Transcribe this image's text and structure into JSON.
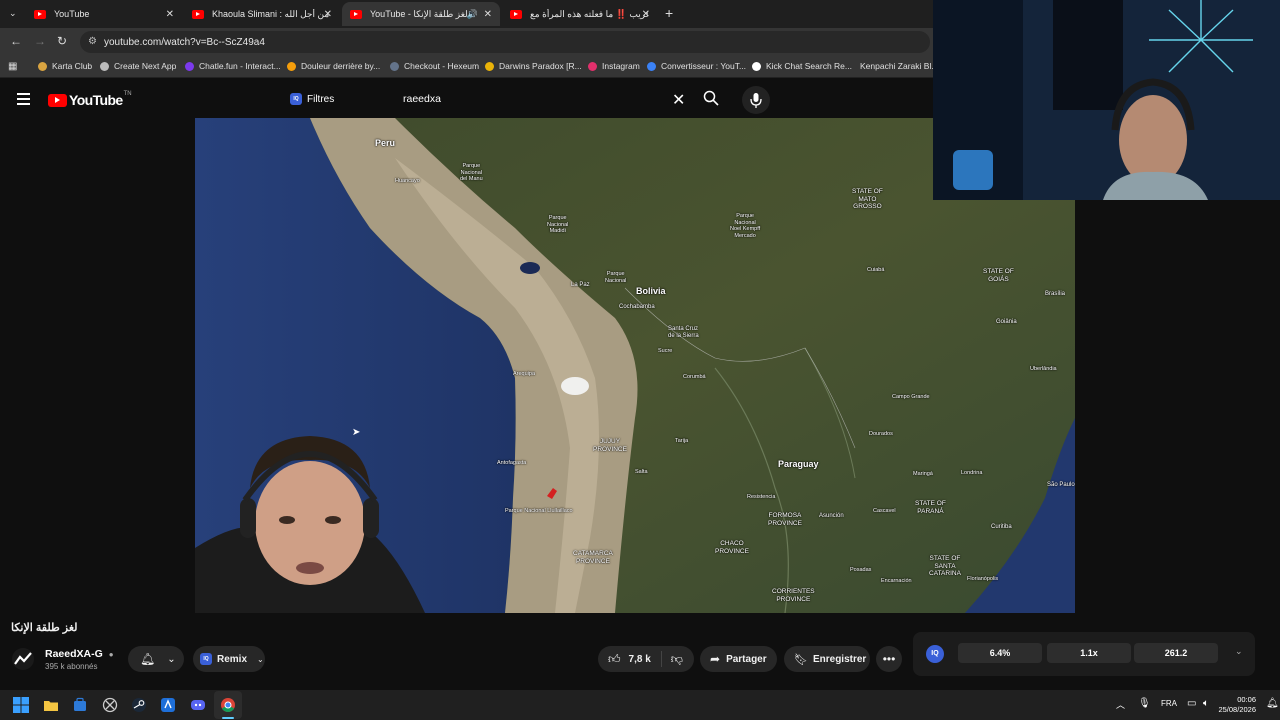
{
  "browser": {
    "tabs": [
      {
        "label": "YouTube",
        "active": false
      },
      {
        "label": "Khaoula Slimani : لو عيّ من أجل الله",
        "active": false
      },
      {
        "label": "YouTube - لغز طلقة الإنكا",
        "active": true
      },
      {
        "label": "عريب ‼️ ما فعلته هذه المرأة مع ..",
        "active": false
      }
    ],
    "new_tab_label": "+",
    "url": "youtube.com/watch?v=Bc--ScZ49a4",
    "bookmarks": [
      {
        "label": "Karta Club",
        "color": "#d9a441"
      },
      {
        "label": "Create Next App",
        "color": "#bbbbbb"
      },
      {
        "label": "Chatle.fun - Interact...",
        "color": "#7c3aed"
      },
      {
        "label": "Douleur derrière by...",
        "color": "#f59e0b"
      },
      {
        "label": "Checkout - Hexeum",
        "color": "#64748b"
      },
      {
        "label": "Darwins Paradox [R...",
        "color": "#eab308"
      },
      {
        "label": "Instagram",
        "color": "#e1306c"
      },
      {
        "label": "Convertisseur : YouT...",
        "color": "#3b82f6"
      },
      {
        "label": "Kick Chat Search Re...",
        "color": "#ffffff"
      },
      {
        "label": "Kenpachi Zaraki Bl...",
        "color": "#ffffff"
      }
    ]
  },
  "youtube": {
    "logo_text": "YouTube",
    "logo_tm": "TN",
    "filters_label": "Filtres",
    "search_value": "raeedxa",
    "video_title": "لغز طلقة الإنكا",
    "channel_name": "RaeedXA-G",
    "subscribers": "395 k abonnés",
    "remix_label": "Remix",
    "likes": "7,8 k",
    "share_label": "Partager",
    "save_label": "Enregistrer",
    "iq_stats": [
      "6.4%",
      "1.1x",
      "261.2"
    ]
  },
  "map_labels": [
    {
      "text": "Peru",
      "size": 9,
      "bold": true
    },
    {
      "text": "Bolivia",
      "size": 9,
      "bold": true
    },
    {
      "text": "Paraguay",
      "size": 9,
      "bold": true
    },
    {
      "text": "STATE OF\nMATO\nGROSSO",
      "size": 6.5,
      "bold": false
    },
    {
      "text": "STATE OF\nGOIÁS",
      "size": 6.5,
      "bold": false
    },
    {
      "text": "STATE OF\nPARANÁ",
      "size": 6.5,
      "bold": false
    },
    {
      "text": "STATE OF\nSANTA\nCATARINA",
      "size": 6.5,
      "bold": false
    },
    {
      "text": "JUJUY\nPROVINCE",
      "size": 6.5,
      "bold": false
    },
    {
      "text": "FORMOSA\nPROVINCE",
      "size": 6.5,
      "bold": false
    },
    {
      "text": "CHACO\nPROVINCE",
      "size": 6.5,
      "bold": false
    },
    {
      "text": "CATAMARCA\nPROVINCE",
      "size": 6.5,
      "bold": false
    },
    {
      "text": "CORRIENTES\nPROVINCE",
      "size": 6.5,
      "bold": false
    },
    {
      "text": "Parque\nNacional\ndel Manu",
      "size": 5.5,
      "bold": false
    },
    {
      "text": "Parque\nNacional\nMadidi",
      "size": 5.5,
      "bold": false
    },
    {
      "text": "Parque\nNacional\nNoel Kempff\nMercado",
      "size": 5.5,
      "bold": false
    },
    {
      "text": "Parque\nNacional",
      "size": 5.5,
      "bold": false
    },
    {
      "text": "La Paz",
      "size": 6,
      "bold": false
    },
    {
      "text": "Cochabamba",
      "size": 6,
      "bold": false
    },
    {
      "text": "Santa Cruz\nde la Sierra",
      "size": 6,
      "bold": false
    },
    {
      "text": "Asunción",
      "size": 6,
      "bold": false
    },
    {
      "text": "Campo Grande",
      "size": 5.5,
      "bold": false
    },
    {
      "text": "Brasília",
      "size": 6,
      "bold": false
    },
    {
      "text": "Goiânia",
      "size": 6,
      "bold": false
    },
    {
      "text": "Curitiba",
      "size": 6,
      "bold": false
    },
    {
      "text": "São Paulo",
      "size": 6,
      "bold": false
    },
    {
      "text": "Florianópolis",
      "size": 5.5,
      "bold": false
    },
    {
      "text": "Londrina",
      "size": 5.5,
      "bold": false
    },
    {
      "text": "Uberlândia",
      "size": 5.5,
      "bold": false
    },
    {
      "text": "Cuiabá",
      "size": 5.5,
      "bold": false
    },
    {
      "text": "Arequipa",
      "size": 5.5,
      "bold": false
    },
    {
      "text": "Antofagasta",
      "size": 5.5,
      "bold": false
    },
    {
      "text": "Parque Nacional Llullaillaco",
      "size": 5.5,
      "bold": false
    },
    {
      "text": "Huancayo",
      "size": 5.5,
      "bold": false
    },
    {
      "text": "Sucre",
      "size": 5.5,
      "bold": false
    },
    {
      "text": "Tarija",
      "size": 5.5,
      "bold": false
    },
    {
      "text": "Salta",
      "size": 5.5,
      "bold": false
    },
    {
      "text": "Resistencia",
      "size": 5.5,
      "bold": false
    },
    {
      "text": "Posadas",
      "size": 5.5,
      "bold": false
    },
    {
      "text": "Encarnación",
      "size": 5.5,
      "bold": false
    },
    {
      "text": "Corumbá",
      "size": 5.5,
      "bold": false
    },
    {
      "text": "Dourados",
      "size": 5.5,
      "bold": false
    },
    {
      "text": "Cascavel",
      "size": 5.5,
      "bold": false
    },
    {
      "text": "Maringá",
      "size": 5.5,
      "bold": false
    }
  ],
  "taskbar": {
    "language": "FRA",
    "time": "00:06",
    "date": "25/08/2026"
  }
}
